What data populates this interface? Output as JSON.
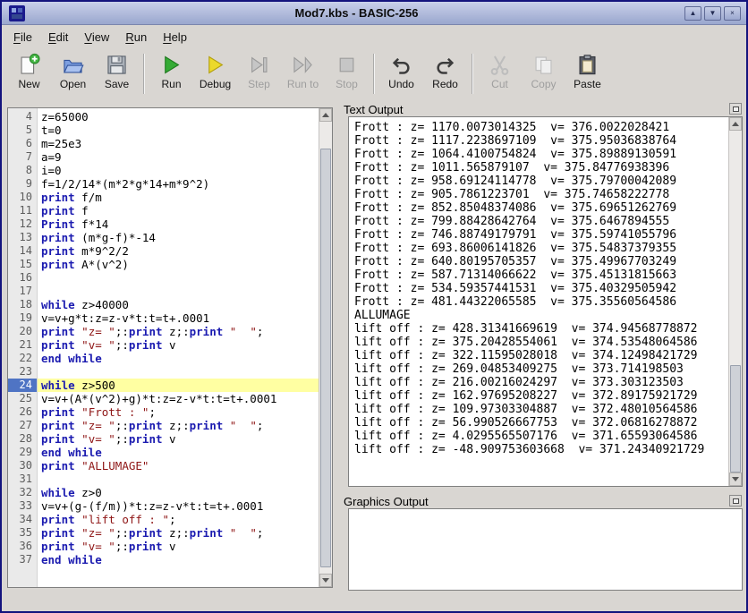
{
  "window": {
    "title": "Mod7.kbs - BASIC-256",
    "controls": [
      {
        "id": "shade",
        "glyph": "▲"
      },
      {
        "id": "minimize",
        "glyph": "▼"
      },
      {
        "id": "close",
        "glyph": "×"
      }
    ]
  },
  "menu": {
    "items": [
      {
        "id": "file",
        "label": "File"
      },
      {
        "id": "edit",
        "label": "Edit"
      },
      {
        "id": "view",
        "label": "View"
      },
      {
        "id": "run",
        "label": "Run"
      },
      {
        "id": "help",
        "label": "Help"
      }
    ]
  },
  "toolbar": {
    "buttons": [
      {
        "id": "new",
        "label": "New",
        "enabled": true,
        "icon": "new-document-icon"
      },
      {
        "id": "open",
        "label": "Open",
        "enabled": true,
        "icon": "open-folder-icon"
      },
      {
        "id": "save",
        "label": "Save",
        "enabled": true,
        "icon": "save-floppy-icon"
      },
      {
        "id": "run",
        "label": "Run",
        "enabled": true,
        "icon": "run-play-icon"
      },
      {
        "id": "debug",
        "label": "Debug",
        "enabled": true,
        "icon": "debug-play-icon"
      },
      {
        "id": "step",
        "label": "Step",
        "enabled": false,
        "icon": "step-icon"
      },
      {
        "id": "runto",
        "label": "Run to",
        "enabled": false,
        "icon": "run-to-icon"
      },
      {
        "id": "stop",
        "label": "Stop",
        "enabled": false,
        "icon": "stop-icon"
      },
      {
        "id": "undo",
        "label": "Undo",
        "enabled": true,
        "icon": "undo-arrow-icon"
      },
      {
        "id": "redo",
        "label": "Redo",
        "enabled": true,
        "icon": "redo-arrow-icon"
      },
      {
        "id": "cut",
        "label": "Cut",
        "enabled": false,
        "icon": "cut-scissors-icon"
      },
      {
        "id": "copy",
        "label": "Copy",
        "enabled": false,
        "icon": "copy-pages-icon"
      },
      {
        "id": "paste",
        "label": "Paste",
        "enabled": true,
        "icon": "paste-clipboard-icon"
      }
    ],
    "separators_after": [
      "save",
      "stop",
      "redo"
    ]
  },
  "editor": {
    "current_line": 24,
    "lines": [
      {
        "num": 4,
        "segments": [
          [
            "plain",
            "z=65000"
          ]
        ]
      },
      {
        "num": 5,
        "segments": [
          [
            "plain",
            "t=0"
          ]
        ]
      },
      {
        "num": 6,
        "segments": [
          [
            "plain",
            "m=25e3"
          ]
        ]
      },
      {
        "num": 7,
        "segments": [
          [
            "plain",
            "a=9"
          ]
        ]
      },
      {
        "num": 8,
        "segments": [
          [
            "plain",
            "i=0"
          ]
        ]
      },
      {
        "num": 9,
        "segments": [
          [
            "plain",
            "f=1/2/14*(m*2*g*14+m*9^2)"
          ]
        ]
      },
      {
        "num": 10,
        "segments": [
          [
            "kw",
            "print"
          ],
          [
            "plain",
            " f/m"
          ]
        ]
      },
      {
        "num": 11,
        "segments": [
          [
            "kw",
            "print"
          ],
          [
            "plain",
            " f"
          ]
        ]
      },
      {
        "num": 12,
        "segments": [
          [
            "kw",
            "Print"
          ],
          [
            "plain",
            " f*14"
          ]
        ]
      },
      {
        "num": 13,
        "segments": [
          [
            "kw",
            "print"
          ],
          [
            "plain",
            " (m*g-f)*-14"
          ]
        ]
      },
      {
        "num": 14,
        "segments": [
          [
            "kw",
            "print"
          ],
          [
            "plain",
            " m*9^2/2"
          ]
        ]
      },
      {
        "num": 15,
        "segments": [
          [
            "kw",
            "print"
          ],
          [
            "plain",
            " A*(v^2)"
          ]
        ]
      },
      {
        "num": 16,
        "segments": []
      },
      {
        "num": 17,
        "segments": []
      },
      {
        "num": 18,
        "segments": [
          [
            "kw",
            "while"
          ],
          [
            "plain",
            " z>40000"
          ]
        ]
      },
      {
        "num": 19,
        "segments": [
          [
            "plain",
            "v=v+g*t:z=z-v*t:t=t+.0001"
          ]
        ]
      },
      {
        "num": 20,
        "segments": [
          [
            "kw",
            "print"
          ],
          [
            "plain",
            " "
          ],
          [
            "str",
            "\"z= \""
          ],
          [
            "plain",
            ";:"
          ],
          [
            "kw",
            "print"
          ],
          [
            "plain",
            " z;:"
          ],
          [
            "kw",
            "print"
          ],
          [
            "plain",
            " "
          ],
          [
            "str",
            "\"  \""
          ],
          [
            "plain",
            ";"
          ]
        ]
      },
      {
        "num": 21,
        "segments": [
          [
            "kw",
            "print"
          ],
          [
            "plain",
            " "
          ],
          [
            "str",
            "\"v= \""
          ],
          [
            "plain",
            ";:"
          ],
          [
            "kw",
            "print"
          ],
          [
            "plain",
            " v"
          ]
        ]
      },
      {
        "num": 22,
        "segments": [
          [
            "kw",
            "end while"
          ]
        ]
      },
      {
        "num": 23,
        "segments": []
      },
      {
        "num": 24,
        "segments": [
          [
            "kw",
            "while"
          ],
          [
            "plain",
            " z>500"
          ]
        ]
      },
      {
        "num": 25,
        "segments": [
          [
            "plain",
            "v=v+(A*(v^2)+g)*t:z=z-v*t:t=t+.0001"
          ]
        ]
      },
      {
        "num": 26,
        "segments": [
          [
            "kw",
            "print"
          ],
          [
            "plain",
            " "
          ],
          [
            "str",
            "\"Frott : \""
          ],
          [
            "plain",
            ";"
          ]
        ]
      },
      {
        "num": 27,
        "segments": [
          [
            "kw",
            "print"
          ],
          [
            "plain",
            " "
          ],
          [
            "str",
            "\"z= \""
          ],
          [
            "plain",
            ";:"
          ],
          [
            "kw",
            "print"
          ],
          [
            "plain",
            " z;:"
          ],
          [
            "kw",
            "print"
          ],
          [
            "plain",
            " "
          ],
          [
            "str",
            "\"  \""
          ],
          [
            "plain",
            ";"
          ]
        ]
      },
      {
        "num": 28,
        "segments": [
          [
            "kw",
            "print"
          ],
          [
            "plain",
            " "
          ],
          [
            "str",
            "\"v= \""
          ],
          [
            "plain",
            ";:"
          ],
          [
            "kw",
            "print"
          ],
          [
            "plain",
            " v"
          ]
        ]
      },
      {
        "num": 29,
        "segments": [
          [
            "kw",
            "end while"
          ]
        ]
      },
      {
        "num": 30,
        "segments": [
          [
            "kw",
            "print"
          ],
          [
            "plain",
            " "
          ],
          [
            "str",
            "\"ALLUMAGE\""
          ]
        ]
      },
      {
        "num": 31,
        "segments": []
      },
      {
        "num": 32,
        "segments": [
          [
            "kw",
            "while"
          ],
          [
            "plain",
            " z>0"
          ]
        ]
      },
      {
        "num": 33,
        "segments": [
          [
            "plain",
            "v=v+(g-(f/m))*t:z=z-v*t:t=t+.0001"
          ]
        ]
      },
      {
        "num": 34,
        "segments": [
          [
            "kw",
            "print"
          ],
          [
            "plain",
            " "
          ],
          [
            "str",
            "\"lift off : \""
          ],
          [
            "plain",
            ";"
          ]
        ]
      },
      {
        "num": 35,
        "segments": [
          [
            "kw",
            "print"
          ],
          [
            "plain",
            " "
          ],
          [
            "str",
            "\"z= \""
          ],
          [
            "plain",
            ";:"
          ],
          [
            "kw",
            "print"
          ],
          [
            "plain",
            " z;:"
          ],
          [
            "kw",
            "print"
          ],
          [
            "plain",
            " "
          ],
          [
            "str",
            "\"  \""
          ],
          [
            "plain",
            ";"
          ]
        ]
      },
      {
        "num": 36,
        "segments": [
          [
            "kw",
            "print"
          ],
          [
            "plain",
            " "
          ],
          [
            "str",
            "\"v= \""
          ],
          [
            "plain",
            ";:"
          ],
          [
            "kw",
            "print"
          ],
          [
            "plain",
            " v"
          ]
        ]
      },
      {
        "num": 37,
        "segments": [
          [
            "kw",
            "end while"
          ]
        ]
      }
    ]
  },
  "output": {
    "title": "Text Output",
    "lines": [
      "Frott : z= 1170.0073014325  v= 376.0022028421",
      "Frott : z= 1117.2238697109  v= 375.95036838764",
      "Frott : z= 1064.4100754824  v= 375.89889130591",
      "Frott : z= 1011.565879107  v= 375.84776938396",
      "Frott : z= 958.69124114778  v= 375.79700042089",
      "Frott : z= 905.7861223701  v= 375.74658222778",
      "Frott : z= 852.85048374086  v= 375.69651262769",
      "Frott : z= 799.88428642764  v= 375.6467894555",
      "Frott : z= 746.88749179791  v= 375.59741055796",
      "Frott : z= 693.86006141826  v= 375.54837379355",
      "Frott : z= 640.80195705357  v= 375.49967703249",
      "Frott : z= 587.71314066622  v= 375.45131815663",
      "Frott : z= 534.59357441531  v= 375.40329505942",
      "Frott : z= 481.44322065585  v= 375.35560564586",
      "ALLUMAGE",
      "lift off : z= 428.31341669619  v= 374.94568778872",
      "lift off : z= 375.20428554061  v= 374.53548064586",
      "lift off : z= 322.11595028018  v= 374.12498421729",
      "lift off : z= 269.04853409275  v= 373.714198503",
      "lift off : z= 216.00216024297  v= 373.303123503",
      "lift off : z= 162.97695208227  v= 372.89175921729",
      "lift off : z= 109.97303304887  v= 372.48010564586",
      "lift off : z= 56.990526667753  v= 372.06816278872",
      "lift off : z= 4.0295565507176  v= 371.65593064586",
      "lift off : z= -48.909753603668  v= 371.24340921729"
    ]
  },
  "graphics": {
    "title": "Graphics Output"
  },
  "colors": {
    "keyword": "#1b1bb0",
    "string": "#8e1515",
    "current_line_bg": "#ffffa2",
    "current_line_number_bg": "#4f74c4",
    "titlebar_top": "#c9d0ea",
    "titlebar_bottom": "#9aa7ce",
    "window_border": "#13137d",
    "run_green": "#35ab35",
    "debug_yellow": "#ecd92a"
  }
}
